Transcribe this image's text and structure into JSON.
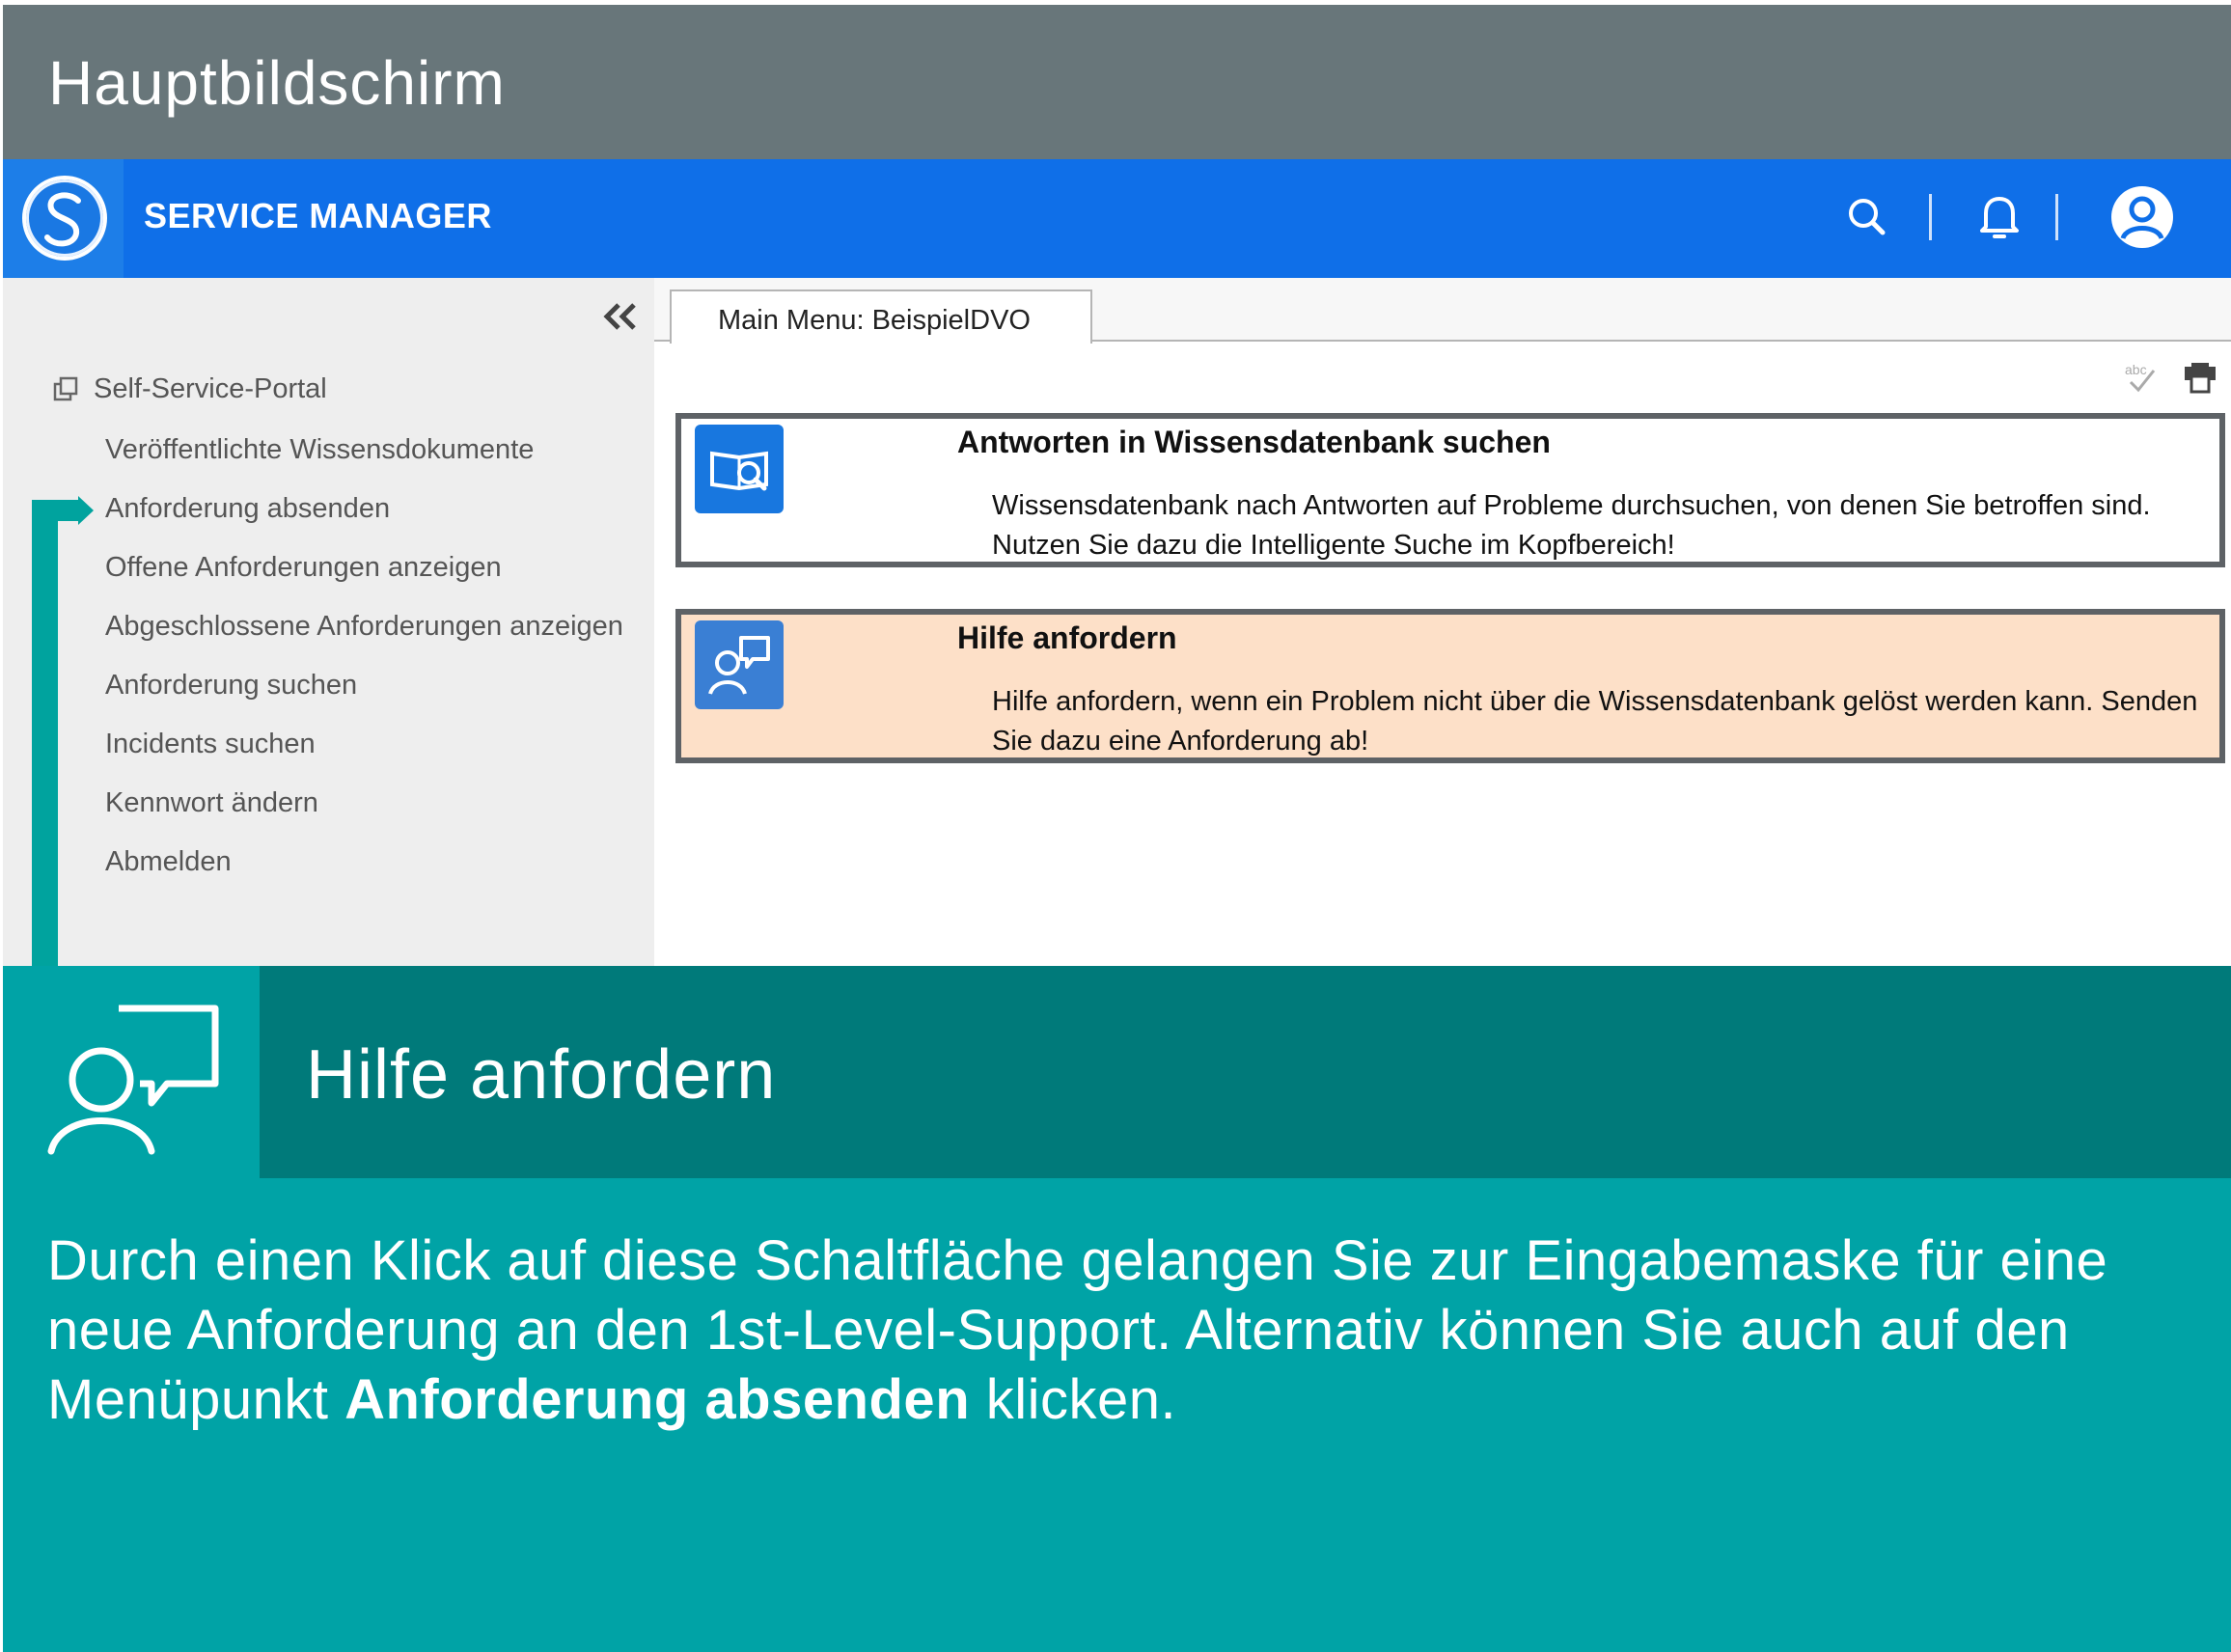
{
  "page_header": {
    "title": "Hauptbildschirm"
  },
  "appbar": {
    "title": "SERVICE MANAGER",
    "icons": [
      "search-icon",
      "bell-icon",
      "user-avatar-icon"
    ],
    "color": "#0f6fe8"
  },
  "sidebar": {
    "collapse_icon": "double-chevron-left-icon",
    "root": {
      "label": "Self-Service-Portal",
      "icon": "copy-icon"
    },
    "items": [
      {
        "label": "Veröffentlichte Wissensdokumente"
      },
      {
        "label": "Anforderung absenden"
      },
      {
        "label": "Offene Anforderungen anzeigen"
      },
      {
        "label": "Abgeschlossene Anforderungen anzeigen"
      },
      {
        "label": "Anforderung suchen"
      },
      {
        "label": "Incidents suchen"
      },
      {
        "label": "Kennwort ändern"
      },
      {
        "label": "Abmelden"
      }
    ],
    "pointer_color": "#00a39e"
  },
  "content": {
    "tab_label": "Main Menu: BeispielDVO",
    "tools": [
      "spellcheck-icon",
      "print-icon"
    ],
    "cards": [
      {
        "title": "Antworten in Wissensdatenbank suchen",
        "description": "Wissensdatenbank nach Antworten auf Probleme durchsuchen, von denen Sie betroffen sind. Nutzen Sie dazu die Intelligente Suche im Kopfbereich!",
        "icon": "book-search-icon",
        "highlighted": false
      },
      {
        "title": "Hilfe anfordern",
        "description": "Hilfe anfordern, wenn ein Problem nicht über die Wissensdatenbank gelöst werden kann. Senden Sie dazu eine Anforderung ab!",
        "icon": "person-speech-icon",
        "highlighted": true,
        "highlight_color": "#fde0c8"
      }
    ]
  },
  "callout": {
    "title": "Hilfe anfordern",
    "icon": "person-speech-icon",
    "text_before": "Durch einen Klick auf diese Schaltfläche gelangen Sie zur Eingabemaske für eine neue Anforderung an den 1st-Level-Support. Alternativ können Sie auch auf den Menüpunkt ",
    "text_bold": "Anforderung absenden",
    "text_after": " klicken.",
    "colors": {
      "dark": "#007a7a",
      "light": "#00a3a6"
    }
  }
}
